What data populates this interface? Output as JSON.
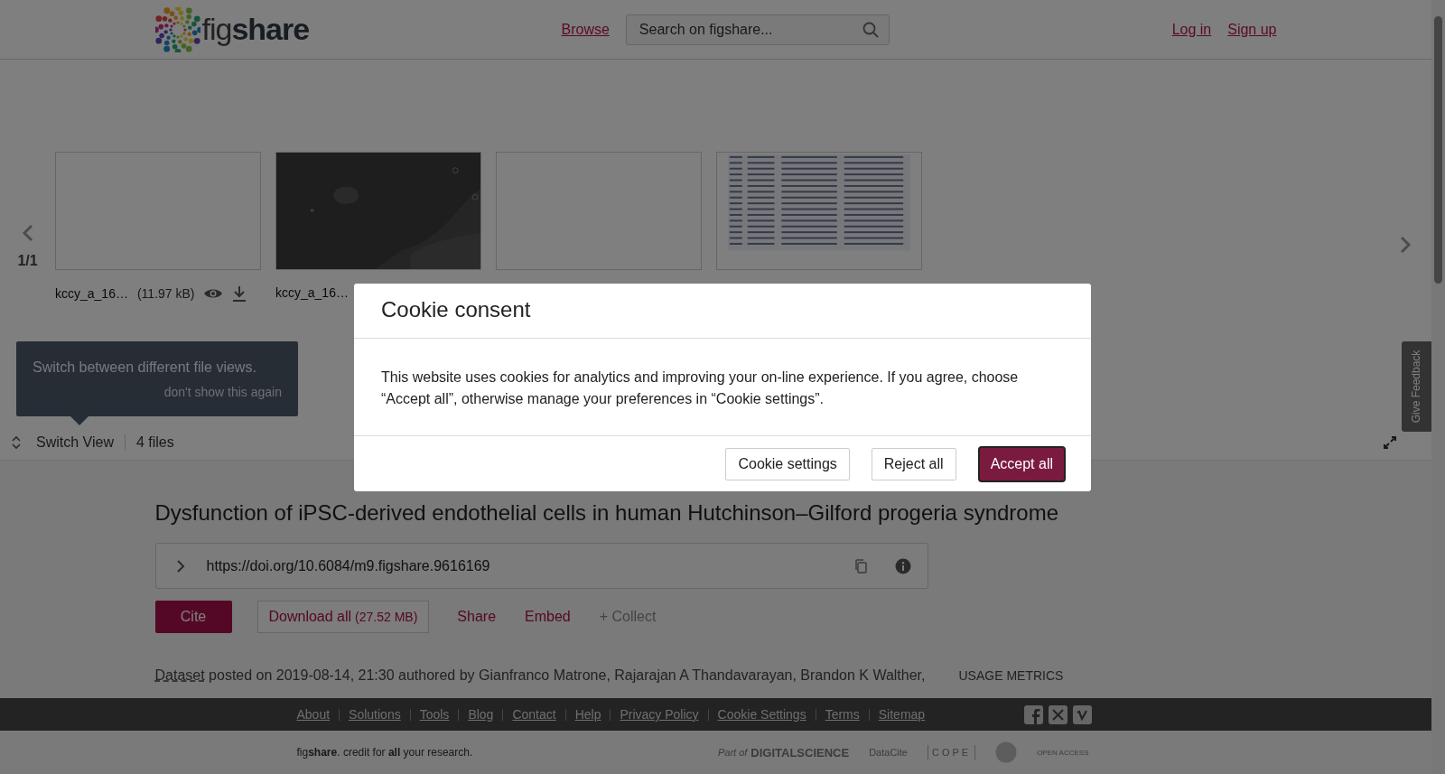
{
  "header": {
    "logo": {
      "light": "fig",
      "bold": "share"
    },
    "browse": "Browse",
    "search": {
      "placeholder": "Search on figshare..."
    },
    "login": "Log in",
    "signup": "Sign up"
  },
  "carousel": {
    "pager": "1/1",
    "files": [
      {
        "kind": "blank",
        "name": "kccy_a_16…",
        "size": "(11.97 kB)"
      },
      {
        "kind": "micrograph",
        "name": "kccy_a_16…"
      },
      {
        "kind": "blank"
      },
      {
        "kind": "table"
      }
    ]
  },
  "tooltip": {
    "text": "Switch between different file views.",
    "dismiss": "don't show this again"
  },
  "toolbar": {
    "switch": "Switch View",
    "count": "4 files"
  },
  "feedback": "Give Feedback",
  "article": {
    "title": "Dysfunction of iPSC-derived endothelial cells in human Hutchinson–Gilford progeria syndrome",
    "doi": "https://doi.org/10.6084/m9.figshare.9616169",
    "actions": [
      {
        "kind": "primary",
        "label": "Cite"
      },
      {
        "kind": "outline",
        "label": "Download all",
        "size": "(27.52 MB)"
      },
      {
        "kind": "link",
        "label": "Share"
      },
      {
        "kind": "link",
        "label": "Embed"
      },
      {
        "kind": "muted",
        "label": "+ Collect"
      }
    ],
    "type": "Dataset",
    "meta": "posted on 2019-08-14, 21:30 authored by Gianfranco Matrone, Rajarajan A Thandavarayan, Brandon K Walther,",
    "metrics": "USAGE METRICS"
  },
  "footer": {
    "links": [
      "About",
      "Solutions",
      "Tools",
      "Blog",
      "Contact",
      "Help",
      "Privacy Policy",
      "Cookie Settings",
      "Terms",
      "Sitemap"
    ],
    "tagline": "fig**share**. credit for **all** your research.",
    "partners": [
      "Part of",
      "DIGITALSCIENCE",
      "DataCite",
      "COPE",
      "OPEN ACCESS"
    ]
  },
  "modal": {
    "title": "Cookie consent",
    "body": "This website uses cookies for analytics and improving your on-line experience. If you agree, choose “Accept all”, otherwise manage your preferences in “Cookie settings”.",
    "buttons": [
      {
        "kind": "secondary",
        "label": "Cookie settings"
      },
      {
        "kind": "secondary",
        "label": "Reject all"
      },
      {
        "kind": "primary",
        "label": "Accept all"
      }
    ]
  }
}
